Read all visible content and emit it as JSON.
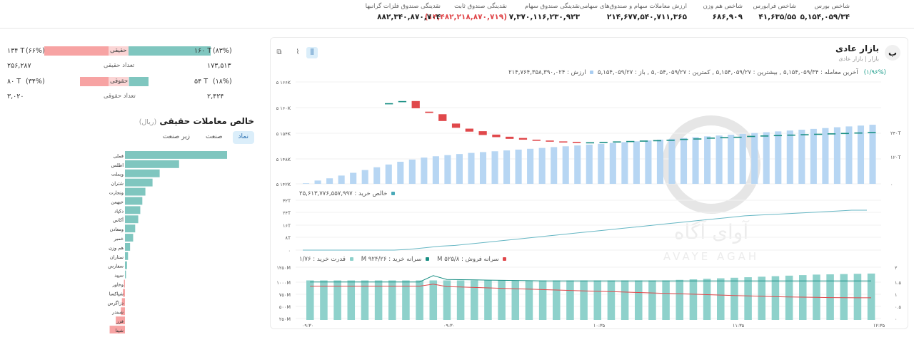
{
  "ticker": [
    {
      "label": "شاخص بورس",
      "value": "۵,۱۵۴,۰۵۹/۳۴",
      "neg": false
    },
    {
      "label": "شاخص فرابورس",
      "value": "۴۱,۶۳۵/۵۵",
      "neg": false
    },
    {
      "label": "شاخص هم وزن",
      "value": "۶۸۶,۹۰۹",
      "neg": false
    },
    {
      "label": "ارزش معاملات سهام و صندوق‌های سهامی",
      "value": "۲۱۴,۶۷۷,۵۴۰,۷۱۱,۳۶۵",
      "neg": false
    },
    {
      "label": "نقدینگی صندوق سهام",
      "value": "۷,۳۷۰,۱۱۶,۲۳۰,۹۲۳",
      "neg": false
    },
    {
      "label": "نقدینگی صندوق ثابت",
      "value": "(۱۴,۴۸۲,۲۱۸,۸۷۰,۷۱۹)",
      "neg": true
    },
    {
      "label": "نقدینگی صندوق فلزات گرانبها",
      "value": "۸۸۲,۳۴۰,۸۷۰,۷۰۴",
      "neg": false
    }
  ],
  "real_block": {
    "buy_pct": "(۸۳%)",
    "buy_value": "۱۶۰ T",
    "buy_label": "حقیقی",
    "sell_pct": "(۶۶%)",
    "sell_value": "۱۳۴ T",
    "count_label": "تعداد حقیقی",
    "count_buy": "۱۷۳,۵۱۳",
    "count_sell": "۲۵۶,۲۸۷"
  },
  "legal_block": {
    "buy_pct": "(۱۸%)",
    "buy_value": "۵۴ T",
    "buy_label": "حقوقی",
    "sell_pct": "(۳۴%)",
    "sell_value": "۸۰ T",
    "count_label": "تعداد حقوقی",
    "count_buy": "۲,۴۲۴",
    "count_sell": "۳,۰۲۰"
  },
  "net_real": {
    "title": "خالص معاملات حقیقی",
    "unit": "(ریال)",
    "tabs": [
      "نماد",
      "صنعت",
      "زیر صنعت"
    ],
    "active_tab": 0,
    "items": [
      {
        "name": "فملی",
        "v": 1.0
      },
      {
        "name": "اطلس",
        "v": 0.53
      },
      {
        "name": "وبملت",
        "v": 0.34
      },
      {
        "name": "شتران",
        "v": 0.27
      },
      {
        "name": "وتجارت",
        "v": 0.2
      },
      {
        "name": "خبهمن",
        "v": 0.17
      },
      {
        "name": "دکپاد",
        "v": 0.15
      },
      {
        "name": "آکاس",
        "v": 0.13
      },
      {
        "name": "ومعادن",
        "v": 0.1
      },
      {
        "name": "خمیر",
        "v": 0.08
      },
      {
        "name": "هم وزن",
        "v": 0.05
      },
      {
        "name": "ستاران",
        "v": 0.03
      },
      {
        "name": "سفارس",
        "v": 0.02
      },
      {
        "name": "سپید",
        "v": 0.01
      },
      {
        "name": "وخاور",
        "v": -0.01
      },
      {
        "name": "شپاکسا",
        "v": -0.02
      },
      {
        "name": "دزاگرس",
        "v": -0.03
      },
      {
        "name": "شبندر",
        "v": -0.04
      },
      {
        "name": "فزر",
        "v": -0.09
      },
      {
        "name": "شپنا",
        "v": -0.15
      }
    ]
  },
  "market": {
    "title": "بازار عادی",
    "subtitle": "بازار | بازار عادی",
    "logo_letter": "ب",
    "legend_top": {
      "change": "(۱/۹۶%)",
      "last": "آخرین معامله : ۵,۱۵۴,۰۵۹/۳۴",
      "high": "بیشترین : ۵,۱۵۴,۰۵۹/۲۷",
      "low": "کمترین : ۵,۰۵۴,۰۵۹/۲۷",
      "open": "باز : ۵,۱۵۴,۰۵۹/۲۷",
      "value": "ارزش : ۲۱۴,۷۶۴,۳۵۸,۳۹۰,۰۲۴"
    },
    "legend_mid": "خالص خرید : ۲۵,۶۱۳,۷۷۶,۵۵۷,۹۹۷",
    "legend_bot": {
      "sell_per": "سرانه فروش : ۵۲۵/۸ M",
      "buy_per": "سرانه خرید : ۹۲۴/۲۶ M",
      "power": "قدرت خرید : ۱/۷۶"
    },
    "watermark": "آوای آگاه",
    "watermark_en": "AVAYE AGAH"
  },
  "chart_data": [
    {
      "type": "bar",
      "name": "price-candles-and-value",
      "y_ticks": [
        "۵ ۱۶۶K",
        "۵ ۱۶۰K",
        "۵ ۱۵۴K",
        "۵ ۱۴۸K",
        "۵ ۱۴۲K"
      ],
      "y_right_ticks": [
        "۲۴۰T",
        "۱۲۰T",
        "۰"
      ],
      "candles": [
        {
          "o": 5161,
          "c": 5161
        },
        {
          "o": 5161.5,
          "c": 5161.5
        },
        {
          "o": 5161.5,
          "c": 5159.8
        },
        {
          "o": 5159,
          "c": 5158.7
        },
        {
          "o": 5158.4,
          "c": 5156.8
        },
        {
          "o": 5156.2,
          "c": 5155.2
        },
        {
          "o": 5155,
          "c": 5154.3
        },
        {
          "o": 5154.4,
          "c": 5153.5
        },
        {
          "o": 5153.6,
          "c": 5153
        },
        {
          "o": 5153.1,
          "c": 5152.6
        },
        {
          "o": 5152.8,
          "c": 5152.4
        },
        {
          "o": 5152.4,
          "c": 5152.2
        },
        {
          "o": 5152.2,
          "c": 5152.0
        },
        {
          "o": 5152.0,
          "c": 5151.9
        },
        {
          "o": 5151.9,
          "c": 5151.8
        },
        {
          "o": 5151.8,
          "c": 5151.8
        },
        {
          "o": 5151.8,
          "c": 5151.9
        },
        {
          "o": 5151.9,
          "c": 5152.0
        },
        {
          "o": 5152.0,
          "c": 5152.1
        },
        {
          "o": 5152.1,
          "c": 5152.2
        },
        {
          "o": 5152.2,
          "c": 5152.3
        },
        {
          "o": 5152.3,
          "c": 5152.4
        },
        {
          "o": 5152.4,
          "c": 5152.6
        },
        {
          "o": 5152.6,
          "c": 5152.7
        },
        {
          "o": 5152.7,
          "c": 5152.9
        },
        {
          "o": 5152.9,
          "c": 5153.0
        },
        {
          "o": 5153.0,
          "c": 5153.1
        },
        {
          "o": 5153.1,
          "c": 5153.3
        },
        {
          "o": 5153.3,
          "c": 5153.4
        },
        {
          "o": 5153.4,
          "c": 5153.5
        },
        {
          "o": 5153.5,
          "c": 5153.6
        },
        {
          "o": 5153.6,
          "c": 5153.7
        },
        {
          "o": 5153.7,
          "c": 5153.8
        },
        {
          "o": 5153.8,
          "c": 5153.9
        },
        {
          "o": 5153.9,
          "c": 5154.0
        },
        {
          "o": 5154.0,
          "c": 5154.1
        },
        {
          "o": 5154.1,
          "c": 5154.2
        }
      ],
      "value_bars": [
        2,
        12,
        20,
        30,
        40,
        50,
        60,
        70,
        80,
        88,
        95,
        100,
        104,
        108,
        112,
        115,
        118,
        121,
        124,
        127,
        130,
        133,
        136,
        139,
        142,
        145,
        148,
        151,
        154,
        157,
        160,
        163,
        166,
        169,
        172,
        175,
        178,
        181,
        184,
        187,
        190,
        193,
        196,
        199,
        202,
        205,
        208,
        211,
        214
      ]
    },
    {
      "type": "line",
      "name": "net-real-buy",
      "y_ticks": [
        "۳۲T",
        "۲۴T",
        "۱۶T",
        "۸T",
        "۰"
      ],
      "values": [
        0,
        0,
        0,
        0,
        0,
        0,
        0,
        0.5,
        1.5,
        2.5,
        3,
        4,
        5,
        6,
        7,
        8,
        9,
        10,
        11,
        12,
        13,
        14,
        15,
        16,
        17,
        18,
        19,
        20,
        21,
        22,
        22.5,
        23,
        23.5,
        24,
        24.5,
        25,
        25.6,
        25.6
      ]
    },
    {
      "type": "bar",
      "name": "buy-power",
      "y_ticks": [
        "۱۲۵۰M",
        "۱۰۰۰M",
        "۷۵۰M",
        "۵۰۰M",
        "۲۵۰M"
      ],
      "y_right_ticks": [
        "۲",
        "۱.۵",
        "۱",
        "۰.۵",
        "۰"
      ],
      "x_ticks": [
        "۰۹:۳۰",
        "۰۹:۳۰",
        "۱۰:۳۵",
        "۱۱:۳۵",
        "۱۲:۳۵"
      ],
      "bars": [
        1.5,
        1.5,
        1.5,
        1.5,
        1.5,
        1.5,
        1.5,
        1.5,
        1.5,
        1.5,
        1.5,
        1.5,
        1.5,
        1.5,
        1.5,
        1.5,
        1.5,
        1.5,
        1.5,
        1.5,
        1.5,
        1.5,
        1.5,
        1.5,
        1.5,
        1.5,
        1.5,
        1.52,
        1.54,
        1.56,
        1.58,
        1.6,
        1.62,
        1.64,
        1.66,
        1.68,
        1.7,
        1.72,
        1.73,
        1.74,
        1.75,
        1.76
      ],
      "buy_per_capita": [
        900,
        900,
        900,
        900,
        900,
        900,
        900,
        900,
        900,
        1050,
        960,
        955,
        950,
        945,
        940,
        935,
        930,
        925,
        925,
        925,
        925,
        925,
        925,
        925,
        925,
        925,
        925,
        925,
        925,
        924,
        924,
        924,
        924,
        924,
        924,
        924,
        924,
        924,
        924,
        924,
        924,
        924
      ],
      "sell_per_capita": [
        800,
        800,
        800,
        800,
        800,
        800,
        800,
        800,
        800,
        850,
        790,
        780,
        770,
        760,
        750,
        740,
        730,
        720,
        710,
        700,
        690,
        680,
        670,
        660,
        650,
        640,
        630,
        620,
        610,
        600,
        590,
        580,
        570,
        560,
        550,
        545,
        540,
        535,
        530,
        528,
        526,
        525
      ]
    }
  ]
}
